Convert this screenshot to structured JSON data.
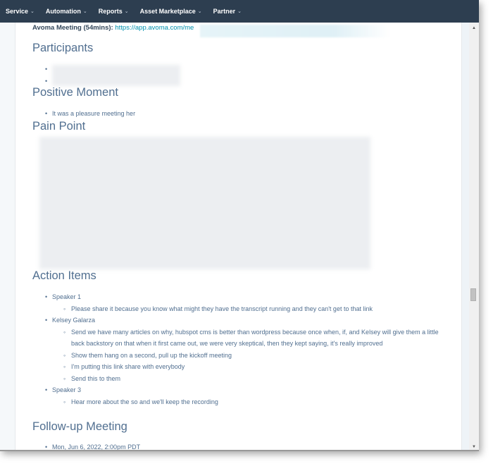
{
  "topnav": {
    "items": [
      {
        "label": "Service"
      },
      {
        "label": "Automation"
      },
      {
        "label": "Reports"
      },
      {
        "label": "Asset Marketplace"
      },
      {
        "label": "Partner"
      }
    ],
    "chevron": "⌄"
  },
  "meeting": {
    "label": "Avoma Meeting (54mins):",
    "link": "https://app.avoma.com/me"
  },
  "sections": {
    "participants": {
      "title": "Participants"
    },
    "positive_moment": {
      "title": "Positive Moment",
      "items": [
        "It was a pleasure meeting her"
      ]
    },
    "pain_point": {
      "title": "Pain Point"
    },
    "action_items": {
      "title": "Action Items",
      "speakers": [
        {
          "name": "Speaker 1",
          "items": [
            "Please share it because you know what might they have the transcript running and they can't get to that link"
          ]
        },
        {
          "name": "Kelsey Galarza",
          "items": [
            "Send we have many articles on why, hubspot cms is better than wordpress because once when, if, and Kelsey will give them a little back backstory on that when it first came out, we were very skeptical, then they kept saying, it's really improved",
            "Show them hang on a second, pull up the kickoff meeting",
            "I'm putting this link share with everybody",
            "Send this to them"
          ]
        },
        {
          "name": "Speaker 3",
          "items": [
            "Hear more about the so and we'll keep the recording"
          ]
        }
      ]
    },
    "follow_up": {
      "title": "Follow-up Meeting",
      "items": [
        "Mon, Jun 6, 2022, 2:00pm PDT"
      ]
    }
  },
  "scrollbar": {
    "up_arrow": "▲",
    "down_arrow": "▼"
  },
  "colors": {
    "nav_bg": "#2d3e50",
    "link": "#0091ae",
    "heading": "#516f90"
  }
}
